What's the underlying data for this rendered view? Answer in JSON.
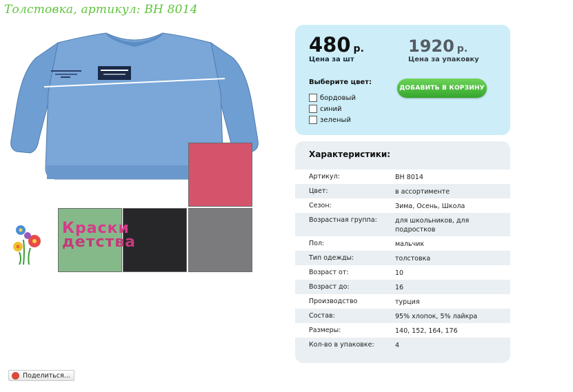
{
  "title": "Толстовка, артикул: ВН 8014",
  "brand": {
    "line1": "Краски",
    "line2": "детства"
  },
  "price": {
    "unit_value": "480",
    "unit_currency": "р.",
    "unit_caption": "Цена за шт",
    "pack_value": "1920",
    "pack_currency": "р.",
    "pack_caption": "Цена за упаковку"
  },
  "color_select": {
    "heading": "Выберите цвет:",
    "options": [
      "бордовый",
      "синий",
      "зеленый"
    ]
  },
  "add_to_cart_label": "ДОБАВИТЬ В КОРЗИНУ",
  "characteristics": {
    "heading": "Характеристики:",
    "rows": [
      {
        "k": "Артикул:",
        "v": "ВН 8014"
      },
      {
        "k": "Цвет:",
        "v": "в ассортименте"
      },
      {
        "k": "Сезон:",
        "v": "Зима, Осень, Школа"
      },
      {
        "k": "Возрастная группа:",
        "v": "для школьников, для подростков"
      },
      {
        "k": "Пол:",
        "v": "мальчик"
      },
      {
        "k": "Тип одежды:",
        "v": "толстовка"
      },
      {
        "k": "Возраст от:",
        "v": "10"
      },
      {
        "k": "Возраст до:",
        "v": "16"
      },
      {
        "k": "Производство",
        "v": "турция"
      },
      {
        "k": "Состав:",
        "v": "95% хлопок, 5% лайкра"
      },
      {
        "k": "Размеры:",
        "v": "140, 152, 164, 176"
      },
      {
        "k": "Кол-во в упаковке:",
        "v": "4"
      }
    ]
  },
  "share_label": "Поделиться...",
  "colors": {
    "title_green": "#5fc43c",
    "sweater_blue": "#6f9ed2",
    "swatch_pink": "#d5546c",
    "swatch_green": "#86b98a",
    "swatch_black": "#27272a",
    "swatch_grey": "#7b7b7d",
    "button_green": "#3fae33",
    "panel_blue": "#cdeef8"
  }
}
